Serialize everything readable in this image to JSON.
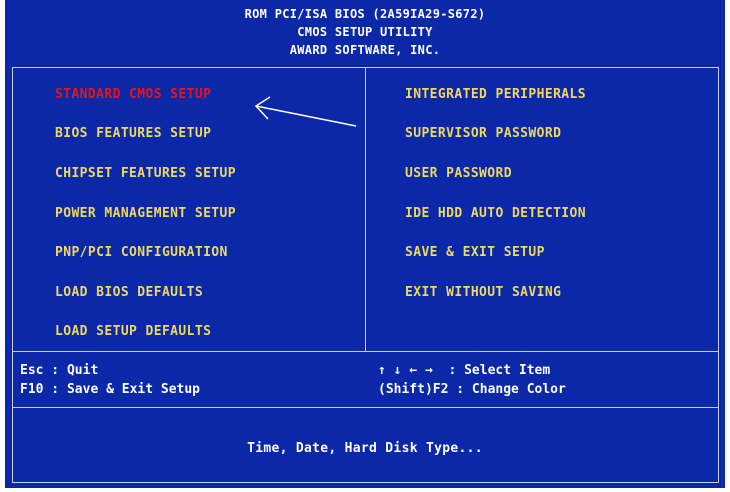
{
  "header": {
    "line1": "ROM PCI/ISA BIOS (2A59IA29-S672)",
    "line2": "CMOS SETUP UTILITY",
    "line3": "AWARD SOFTWARE, INC."
  },
  "menu": {
    "left": [
      "STANDARD CMOS SETUP",
      "BIOS FEATURES SETUP",
      "CHIPSET FEATURES SETUP",
      "POWER MANAGEMENT SETUP",
      "PNP/PCI CONFIGURATION",
      "LOAD BIOS DEFAULTS",
      "LOAD SETUP DEFAULTS"
    ],
    "right": [
      "INTEGRATED PERIPHERALS",
      "SUPERVISOR PASSWORD",
      "USER PASSWORD",
      "IDE HDD AUTO DETECTION",
      "SAVE & EXIT SETUP",
      "EXIT WITHOUT SAVING"
    ],
    "selected": "STANDARD CMOS SETUP"
  },
  "keys": {
    "esc": "Esc : Quit",
    "f10": "F10 : Save & Exit Setup",
    "arrows": "↑ ↓ ← →  : Select Item",
    "shift_f2": "(Shift)F2 : Change Color"
  },
  "description": "Time, Date, Hard Disk Type...",
  "colors": {
    "background": "#0a28a8",
    "item": "#f0d860",
    "selected": "#e8141c",
    "text": "#ffffff"
  }
}
